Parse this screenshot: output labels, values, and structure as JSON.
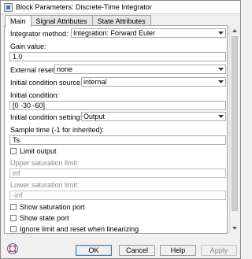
{
  "window": {
    "title": "Block Parameters: Discrete-Time Integrator"
  },
  "tabs": [
    {
      "label": "Main",
      "active": true
    },
    {
      "label": "Signal Attributes",
      "active": false
    },
    {
      "label": "State Attributes",
      "active": false
    }
  ],
  "main": {
    "integrator_method": {
      "label": "Integrator method:",
      "value": "Integration: Forward Euler"
    },
    "gain_value": {
      "label": "Gain value:",
      "value": "1.0"
    },
    "external_reset": {
      "label": "External reset:",
      "value": "none"
    },
    "initial_condition_source": {
      "label": "Initial condition source:",
      "value": "internal"
    },
    "initial_condition": {
      "label": "Initial condition:",
      "value": "[0 -30 -60]"
    },
    "initial_condition_setting": {
      "label": "Initial condition setting:",
      "value": "Output"
    },
    "sample_time": {
      "label": "Sample time (-1 for inherited):",
      "value": "Ts"
    },
    "limit_output": {
      "label": "Limit output",
      "checked": false
    },
    "upper_saturation_limit": {
      "label": "Upper saturation limit:",
      "value": "inf",
      "enabled": false
    },
    "lower_saturation_limit": {
      "label": "Lower saturation limit:",
      "value": "-inf",
      "enabled": false
    },
    "show_saturation_port": {
      "label": "Show saturation port",
      "checked": false,
      "enabled": false
    },
    "show_state_port": {
      "label": "Show state port",
      "checked": false
    },
    "ignore_limit_reset": {
      "label": "Ignore limit and reset when linearizing",
      "checked": false
    }
  },
  "buttons": {
    "ok": "OK",
    "cancel": "Cancel",
    "help": "Help",
    "apply": "Apply"
  },
  "colors": {
    "ok_border": "#3c7fb1",
    "panel": "#ffffff",
    "chrome": "#f0f0f0"
  },
  "icons": {
    "app": "block-parameters-icon",
    "help": "help-icon"
  }
}
